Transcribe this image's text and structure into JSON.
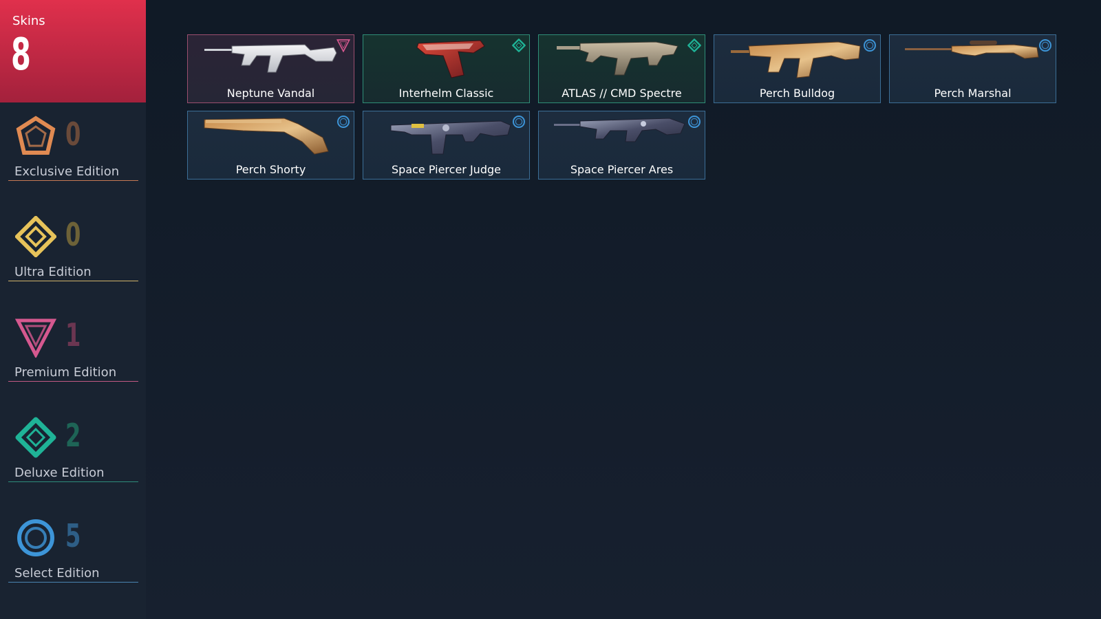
{
  "summary": {
    "label": "Skins",
    "count": "8"
  },
  "tiers": [
    {
      "name": "Exclusive Edition",
      "count": "0",
      "icon": "exclusive-edition-icon",
      "color": "#e08a52",
      "count_color": "#6a4a3a",
      "line_color": "#c77a55"
    },
    {
      "name": "Ultra Edition",
      "count": "0",
      "icon": "ultra-edition-icon",
      "color": "#e7c35a",
      "count_color": "#6d6238",
      "line_color": "#d2b36a"
    },
    {
      "name": "Premium Edition",
      "count": "1",
      "icon": "premium-edition-icon",
      "color": "#d5588f",
      "count_color": "#6b3651",
      "line_color": "#c35a85"
    },
    {
      "name": "Deluxe Edition",
      "count": "2",
      "icon": "deluxe-edition-icon",
      "color": "#1fb397",
      "count_color": "#1e6456",
      "line_color": "#2e8e7c"
    },
    {
      "name": "Select Edition",
      "count": "5",
      "icon": "select-edition-icon",
      "color": "#3d95d8",
      "count_color": "#2e5e86",
      "line_color": "#4a86b4"
    }
  ],
  "skins": [
    {
      "name": "Neptune Vandal",
      "tier": "premium",
      "gun": "vandal"
    },
    {
      "name": "Interhelm Classic",
      "tier": "deluxe",
      "gun": "classic"
    },
    {
      "name": "ATLAS // CMD Spectre",
      "tier": "deluxe",
      "gun": "spectre"
    },
    {
      "name": "Perch Bulldog",
      "tier": "select",
      "gun": "bulldog"
    },
    {
      "name": "Perch Marshal",
      "tier": "select",
      "gun": "marshal"
    },
    {
      "name": "Perch Shorty",
      "tier": "select",
      "gun": "shorty"
    },
    {
      "name": "Space Piercer Judge",
      "tier": "select",
      "gun": "judge"
    },
    {
      "name": "Space Piercer Ares",
      "tier": "select",
      "gun": "ares"
    }
  ]
}
